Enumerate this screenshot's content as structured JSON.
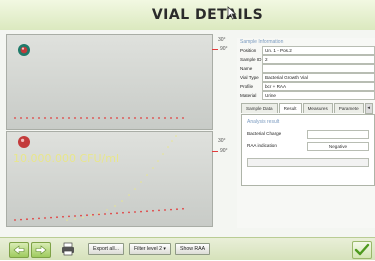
{
  "window": {
    "title": "VIAL DETAILS"
  },
  "graphs": {
    "top": {
      "axis_top_label": "30°",
      "axis_mid_label": "90°"
    },
    "bottom": {
      "cfu_label": "10.000.000 CFU/ml",
      "axis_top_label": "30°",
      "axis_mid_label": "90°"
    }
  },
  "sample_info": {
    "header": "Sample Information",
    "fields": [
      {
        "label": "Position",
        "value": "Un. 1 - Pos.2"
      },
      {
        "label": "Sample ID",
        "value": "2"
      },
      {
        "label": "Name",
        "value": ""
      },
      {
        "label": "Vial Type",
        "value": "Bacterial Growth Vial"
      },
      {
        "label": "Profile",
        "value": "bcr + RAA"
      },
      {
        "label": "Material",
        "value": "Urine"
      }
    ]
  },
  "tabs": [
    {
      "label": "Sample Data"
    },
    {
      "label": "Result"
    },
    {
      "label": "Measures"
    },
    {
      "label": "Paramete"
    }
  ],
  "tabs_nav": {
    "label": "◂"
  },
  "result": {
    "header": "Analysis result",
    "bacterial_charge_label": "Bacterial Charge",
    "bacterial_charge_value": "",
    "raa_label": "RAA indication",
    "raa_value": "Negative"
  },
  "footer": {
    "export_label": "Export all...",
    "filter_label": "Filter level 2",
    "filter_arrow": "▾",
    "show_raa_label": "Show RAA"
  },
  "colors": {
    "accent_green": "#9fcb5f",
    "graph_red": "#e23b3b",
    "curve_yellow": "#e8e68c"
  }
}
